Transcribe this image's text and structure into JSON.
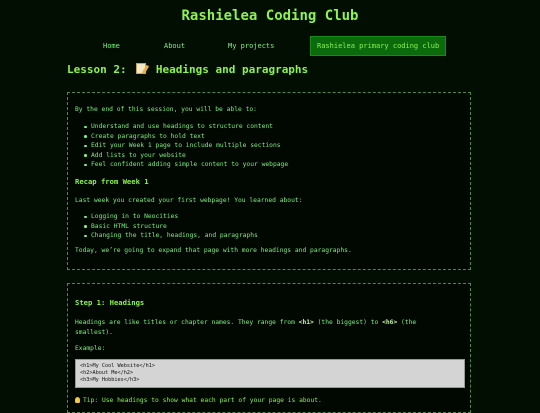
{
  "site": {
    "title": "Rashielea Coding Club"
  },
  "nav": {
    "items": [
      {
        "label": "Home"
      },
      {
        "label": "About"
      },
      {
        "label": "My projects"
      },
      {
        "label": "Rashielea primary coding club"
      }
    ]
  },
  "lesson": {
    "title_prefix": "Lesson 2:",
    "title_text": "Headings and paragraphs",
    "title_icon": "memo-icon"
  },
  "intro": {
    "lead": "By the end of this session, you will be able to:",
    "goals": [
      "Understand and use headings to structure content",
      "Create paragraphs to hold text",
      "Edit your Week 1 page to include multiple sections",
      "Add lists to your website",
      "Feel confident adding simple content to your webpage"
    ],
    "recap_heading": "Recap from Week 1",
    "recap_lead": "Last week you created your first webpage! You learned about:",
    "recap_items": [
      "Logging in to Neocities",
      "Basic HTML structure",
      "Changing the title, headings, and paragraphs"
    ],
    "closing": "Today, we’re going to expand that page with more headings and paragraphs."
  },
  "step1": {
    "heading": "Step 1: Headings",
    "desc_a": "Headings are like titles or chapter names. They range from ",
    "tag_h1": "<h1>",
    "desc_b": " (the biggest) to ",
    "tag_h6": "<h6>",
    "desc_c": " (the",
    "desc_d": "smallest).",
    "example_label": "Example:",
    "code_lines": [
      "<h1>My Cool Website</h1>",
      "<h2>About Me</h2>",
      "<h3>My Hobbies</h3>"
    ],
    "tip": "Tip: Use headings to show what each part of your page is about."
  }
}
